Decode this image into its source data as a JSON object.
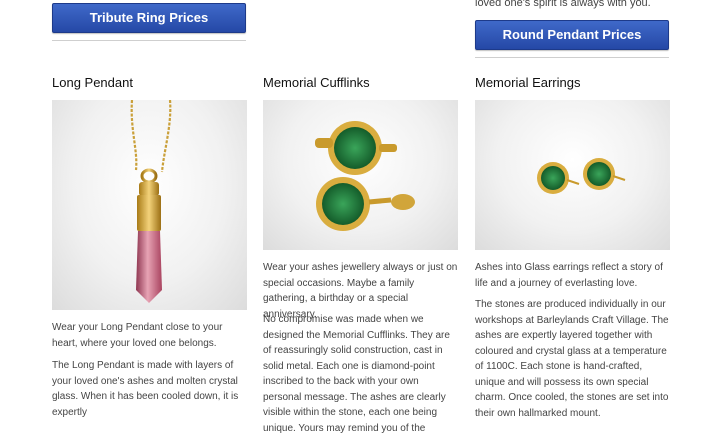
{
  "column1": {
    "button_label": "Tribute Ring Prices",
    "title": "Long Pendant",
    "paragraphs": [
      "Wear your Long Pendant close to your heart, where your loved one belongs.",
      "The Long Pendant is made with layers of your loved one's ashes and molten crystal glass. When it has been cooled down, it is expertly"
    ]
  },
  "column2": {
    "title": "Memorial Cufflinks",
    "paragraphs": [
      "Wear your ashes jewellery always or just on special occasions. Maybe a family gathering, a birthday or a special anniversary.",
      "No compromise was made when we designed the Memorial Cufflinks. They are of reassuringly solid construction, cast in solid metal. Each one is diamond-point inscribed to the back with your own personal message. The ashes are clearly visible within the stone, each one being unique. Yours may remind you of the"
    ]
  },
  "column3": {
    "top_text": "loved one's spirit is always with you.",
    "button_label": "Round Pendant Prices",
    "title": "Memorial Earrings",
    "paragraphs": [
      "Ashes into Glass earrings reflect a story of life and a journey of everlasting love.",
      "The stones are produced individually in our workshops at Barleylands Craft Village. The ashes are expertly layered together with coloured and crystal glass at a temperature of 1100C. Each stone is hand-crafted, unique and will possess its own special charm. Once cooled, the stones are set into their own hallmarked mount."
    ]
  },
  "colors": {
    "button_blue": "#2f55b5",
    "gold": "#d4a531",
    "green_stone": "#1f7a3a",
    "pink_stone": "#c96680"
  }
}
